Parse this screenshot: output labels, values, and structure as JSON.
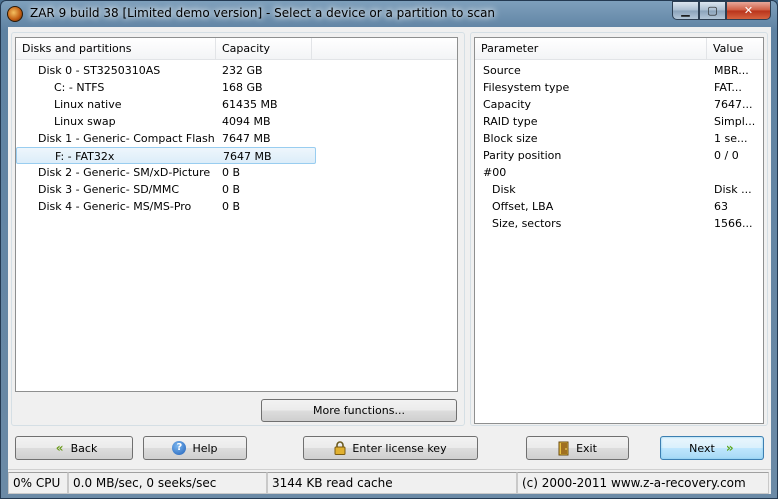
{
  "window": {
    "title": "ZAR 9 build 38 [Limited demo version] - Select a device or a partition to scan",
    "controls": {
      "minimize": "▁",
      "maximize": "▢",
      "close": "✕"
    }
  },
  "disks": {
    "columns": [
      "Disks and partitions",
      "Capacity"
    ],
    "rows": [
      {
        "name": "Disk 0 - ST3250310AS",
        "capacity": "232 GB",
        "indent": 1
      },
      {
        "name": "C: - NTFS",
        "capacity": "168 GB",
        "indent": 2
      },
      {
        "name": "Linux native",
        "capacity": "61435 MB",
        "indent": 2
      },
      {
        "name": "Linux swap",
        "capacity": "4094 MB",
        "indent": 2
      },
      {
        "name": "Disk 1 - Generic- Compact Flash",
        "capacity": "7647 MB",
        "indent": 1
      },
      {
        "name": "F: - FAT32x",
        "capacity": "7647 MB",
        "indent": 2,
        "selected": true
      },
      {
        "name": "Disk 2 - Generic- SM/xD-Picture",
        "capacity": "0 B",
        "indent": 1
      },
      {
        "name": "Disk 3 - Generic- SD/MMC",
        "capacity": "0 B",
        "indent": 1
      },
      {
        "name": "Disk 4 - Generic- MS/MS-Pro",
        "capacity": "0 B",
        "indent": 1
      }
    ]
  },
  "params": {
    "columns": [
      "Parameter",
      "Value"
    ],
    "rows": [
      {
        "name": "Source",
        "value": "MBR...",
        "indent": 0
      },
      {
        "name": "Filesystem type",
        "value": "FAT...",
        "indent": 0
      },
      {
        "name": "Capacity",
        "value": "7647...",
        "indent": 0
      },
      {
        "name": "RAID type",
        "value": "Simpl...",
        "indent": 0
      },
      {
        "name": "Block size",
        "value": "1 se...",
        "indent": 0
      },
      {
        "name": "Parity position",
        "value": "0 / 0",
        "indent": 0
      },
      {
        "name": "#00",
        "value": "",
        "indent": 0
      },
      {
        "name": "Disk",
        "value": "Disk ...",
        "indent": 1
      },
      {
        "name": "Offset, LBA",
        "value": "63",
        "indent": 1
      },
      {
        "name": "Size, sectors",
        "value": "1566...",
        "indent": 1
      }
    ]
  },
  "buttons": {
    "more_functions": "More functions...",
    "back": "Back",
    "help": "Help",
    "license": "Enter license key",
    "exit": "Exit",
    "next": "Next"
  },
  "icons": {
    "back": "«",
    "help": "?",
    "next": "»"
  },
  "status": {
    "cpu": "0% CPU",
    "io": "0.0 MB/sec, 0 seeks/sec",
    "cache": "3144 KB read cache",
    "copyright": "(c) 2000-2011 www.z-a-recovery.com"
  }
}
